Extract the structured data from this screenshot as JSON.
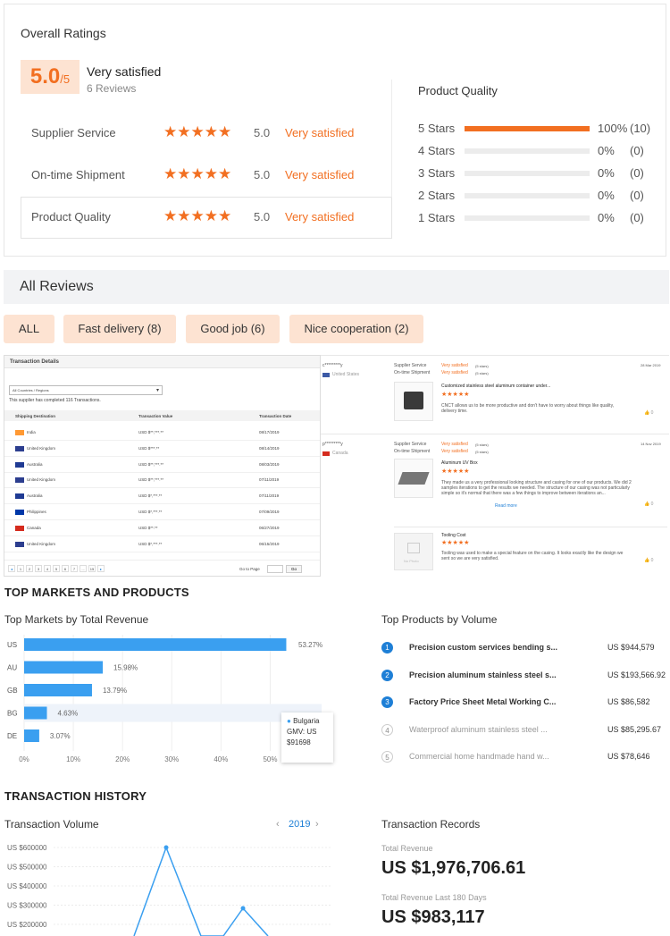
{
  "ratings": {
    "title": "Overall Ratings",
    "score": "5.0",
    "score_max": "/5",
    "score_text": "Very satisfied",
    "reviews_count": "6 Reviews",
    "rows": [
      {
        "label": "Supplier Service",
        "stars": 5,
        "score": "5.0",
        "text": "Very satisfied"
      },
      {
        "label": "On-time Shipment",
        "stars": 5,
        "score": "5.0",
        "text": "Very satisfied"
      },
      {
        "label": "Product Quality",
        "stars": 5,
        "score": "5.0",
        "text": "Very satisfied"
      }
    ],
    "quality": {
      "title": "Product Quality",
      "rows": [
        {
          "label": "5 Stars",
          "fraction": 1.0,
          "pct": "100%",
          "count": "(10)"
        },
        {
          "label": "4 Stars",
          "fraction": 0.0,
          "pct": "0%",
          "count": "(0)"
        },
        {
          "label": "3 Stars",
          "fraction": 0.0,
          "pct": "0%",
          "count": "(0)"
        },
        {
          "label": "2 Stars",
          "fraction": 0.0,
          "pct": "0%",
          "count": "(0)"
        },
        {
          "label": "1 Stars",
          "fraction": 0.0,
          "pct": "0%",
          "count": "(0)"
        }
      ]
    }
  },
  "reviews": {
    "title": "All Reviews",
    "tags": [
      "ALL",
      "Fast delivery (8)",
      "Good job (6)",
      "Nice cooperation (2)"
    ]
  },
  "transactions": {
    "title": "Transaction Details",
    "filter": "All Countries / Regions",
    "summary": "This supplier has completed 116 Transactions.",
    "headers": [
      "Shipping Destination",
      "Transaction Value",
      "Transaction Date"
    ],
    "rows": [
      {
        "country": "India",
        "value": "USD $**,***.**",
        "date": "08/17/2019",
        "flag": "#ff9933"
      },
      {
        "country": "United Kingdom",
        "value": "USD $***.**",
        "date": "08/14/2019",
        "flag": "#2c3e8f"
      },
      {
        "country": "Australia",
        "value": "USD $**,***.**",
        "date": "08/03/2019",
        "flag": "#1f3a93"
      },
      {
        "country": "United Kingdom",
        "value": "USD $**,***.**",
        "date": "07/11/2019",
        "flag": "#2c3e8f"
      },
      {
        "country": "Australia",
        "value": "USD $*,***.**",
        "date": "07/11/2019",
        "flag": "#1f3a93"
      },
      {
        "country": "Philippines",
        "value": "USD $*,***.**",
        "date": "07/09/2019",
        "flag": "#0038a8"
      },
      {
        "country": "Canada",
        "value": "USD $**.**",
        "date": "06/27/2019",
        "flag": "#d52b1e"
      },
      {
        "country": "United Kingdom",
        "value": "USD $*,***.**",
        "date": "06/15/2019",
        "flag": "#2c3e8f"
      }
    ],
    "pager": [
      "1",
      "2",
      "3",
      "4",
      "5",
      "6",
      "7",
      "...",
      "15"
    ],
    "goto_label": "Go to Page",
    "go_button": "Go"
  },
  "review_items": [
    {
      "buyer": "c*********y",
      "country": "United States",
      "date": "28 Mar 2019",
      "service_label": "Supplier Service",
      "service_value": "Very satisfied",
      "service_score": "(5 stars)",
      "shipment_label": "On-time Shipment",
      "shipment_value": "Very satisfied",
      "shipment_score": "(5 stars)",
      "product": "Customized stainless steel aluminum container under...",
      "text": "CNCT allows us to be more productive and don't have to worry about things like quality, delivery time."
    },
    {
      "buyer": "p*********y",
      "country": "Canada",
      "date": "14 Nov 2019",
      "service_label": "Supplier Service",
      "service_value": "Very satisfied",
      "service_score": "(5 stars)",
      "shipment_label": "On-time Shipment",
      "shipment_value": "Very satisfied",
      "shipment_score": "(5 stars)",
      "product": "Aluminum UV Box",
      "text": "They made us a very professional looking structure and casing for one of our products. We did 2 samples iterations to get the results we needed. The structure of our casing was not particularly simple so it's normal that there was a few things to improve between iterations an...",
      "more": "Read more"
    },
    {
      "product": "Tooling Cost",
      "image_label": "No Photo",
      "text": "Tooling was used to make a special feature on the casing. It looks exactly like the design we sent so we are very satisfied."
    }
  ],
  "markets": {
    "section_title": "TOP MARKETS AND PRODUCTS",
    "chart_title": "Top Markets by Total Revenue",
    "tooltip": {
      "series": "Bulgaria",
      "label": "GMV: US",
      "value": "$91698"
    }
  },
  "chart_data": {
    "type": "bar",
    "orientation": "horizontal",
    "categories": [
      "US",
      "AU",
      "GB",
      "BG",
      "DE"
    ],
    "values": [
      53.27,
      15.98,
      13.79,
      4.63,
      3.07
    ],
    "labels": [
      "53.27%",
      "15.98%",
      "13.79%",
      "4.63%",
      "3.07%"
    ],
    "xticks": [
      "0%",
      "10%",
      "20%",
      "30%",
      "40%",
      "50%"
    ],
    "xlim": [
      0,
      55
    ],
    "highlight": "BG",
    "color": "#3a9ff0"
  },
  "products": {
    "title": "Top Products by Volume",
    "items": [
      {
        "rank": "1",
        "name": "Precision custom services bending s...",
        "value": "US $944,579",
        "active": true
      },
      {
        "rank": "2",
        "name": "Precision aluminum stainless steel s...",
        "value": "US $193,566.92",
        "active": true
      },
      {
        "rank": "3",
        "name": "Factory Price Sheet Metal Working C...",
        "value": "US $86,582",
        "active": true
      },
      {
        "rank": "4",
        "name": "Waterproof aluminum stainless steel ...",
        "value": "US $85,295.67",
        "active": false
      },
      {
        "rank": "5",
        "name": "Commercial home handmade hand w...",
        "value": "US $78,646",
        "active": false
      }
    ]
  },
  "history": {
    "section_title": "TRANSACTION HISTORY",
    "volume_title": "Transaction Volume",
    "year": "2019",
    "prev_icon": "‹",
    "next_icon": "›",
    "yticks": [
      "US $600000",
      "US $500000",
      "US $400000",
      "US $300000",
      "US $200000"
    ],
    "records_title": "Transaction Records",
    "total_label": "Total Revenue",
    "total_value": "US $1,976,706.61",
    "last180_label": "Total Revenue Last 180 Days",
    "last180_value": "US $983,117"
  },
  "colors": {
    "accent": "#f26f21",
    "accent_soft": "#fde3d2",
    "bar": "#3a9ff0",
    "rank_active": "#1e7fd6"
  }
}
